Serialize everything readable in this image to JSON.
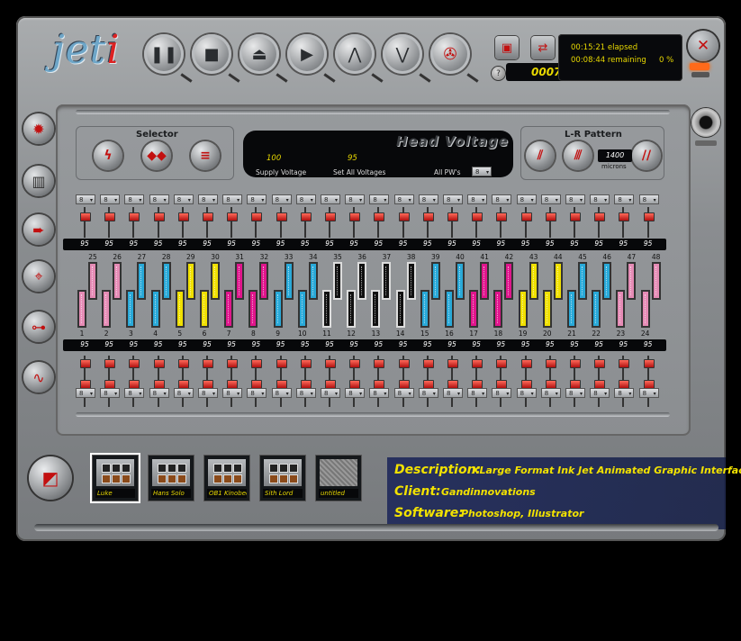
{
  "app": {
    "logo_main": "jet",
    "logo_i": "i"
  },
  "toolbar": {
    "buttons": [
      {
        "icon": "pause-icon",
        "glyph": "❚❚"
      },
      {
        "icon": "stop-icon",
        "glyph": "■"
      },
      {
        "icon": "eject-icon",
        "glyph": "⏏"
      },
      {
        "icon": "play-icon",
        "glyph": "▶"
      },
      {
        "icon": "up-chevrons-icon",
        "glyph": "⋀"
      },
      {
        "icon": "down-chevrons-icon",
        "glyph": "⋁"
      },
      {
        "icon": "fan-icon",
        "glyph": "✇"
      }
    ]
  },
  "status": {
    "elapsed": "00:15:21 elapsed",
    "remaining": "00:08:44 remaining",
    "percent": "0 %",
    "counter": "0007"
  },
  "panel": {
    "selector_title": "Selector",
    "lr_title": "L-R Pattern",
    "head_title": "Head Voltage",
    "supply_value": "100",
    "supply_label": "Supply Voltage",
    "set_all_value": "95",
    "set_all_label": "Set All Voltages",
    "all_pws_label": "All PW's",
    "all_pws_value": "8",
    "microns_value": "1400",
    "microns_label": "microns",
    "dropdown_value": "8",
    "voltage": "95"
  },
  "heads_top": [
    "25",
    "26",
    "27",
    "28",
    "29",
    "30",
    "31",
    "32",
    "33",
    "34",
    "35",
    "36",
    "37",
    "38",
    "39",
    "40",
    "41",
    "42",
    "43",
    "44",
    "45",
    "46",
    "47",
    "48"
  ],
  "heads_bottom": [
    "1",
    "2",
    "3",
    "4",
    "5",
    "6",
    "7",
    "8",
    "9",
    "10",
    "11",
    "12",
    "13",
    "14",
    "15",
    "16",
    "17",
    "18",
    "19",
    "20",
    "21",
    "22",
    "23",
    "24"
  ],
  "head_colors": [
    "#e58bb5",
    "#e58bb5",
    "#29a9d8",
    "#29a9d8",
    "#f0e000",
    "#f0e000",
    "#e0158c",
    "#e0158c",
    "#29a9d8",
    "#29a9d8",
    "#111111",
    "#111111",
    "#111111",
    "#111111",
    "#29a9d8",
    "#29a9d8",
    "#e0158c",
    "#e0158c",
    "#f0e000",
    "#f0e000",
    "#29a9d8",
    "#29a9d8",
    "#e58bb5",
    "#e58bb5"
  ],
  "presets": [
    {
      "label": "Luke",
      "selected": true
    },
    {
      "label": "Hans Solo",
      "selected": false
    },
    {
      "label": "OB1 Kinobee",
      "selected": false
    },
    {
      "label": "Sith Lord",
      "selected": false
    },
    {
      "label": "untitled",
      "selected": false
    }
  ],
  "description": {
    "desc_key": "Description:",
    "desc_val": "XLarge Format Ink Jet  Animated  Graphic Interface",
    "client_key": "Client:",
    "client_val": "Gandinnovations",
    "software_key": "Software:",
    "software_val": "Photoshop, Illustrator"
  }
}
